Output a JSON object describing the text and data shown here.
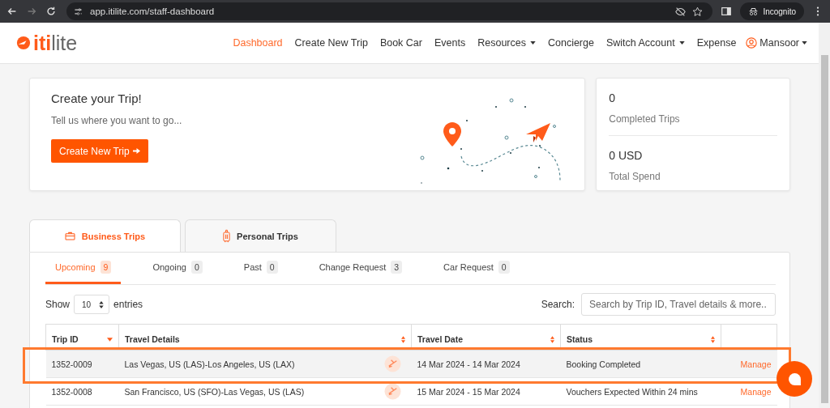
{
  "browser": {
    "url": "app.itilite.com/staff-dashboard",
    "profile": "Incognito"
  },
  "nav": {
    "logo_prefix": "iti",
    "logo_suffix": "lite",
    "items": [
      {
        "label": "Dashboard",
        "selected": true,
        "dropdown": false
      },
      {
        "label": "Create New Trip",
        "selected": false,
        "dropdown": false
      },
      {
        "label": "Book Car",
        "selected": false,
        "dropdown": false
      },
      {
        "label": "Events",
        "selected": false,
        "dropdown": false
      },
      {
        "label": "Resources",
        "selected": false,
        "dropdown": true
      },
      {
        "label": "Concierge",
        "selected": false,
        "dropdown": false
      },
      {
        "label": "Switch Account",
        "selected": false,
        "dropdown": true
      },
      {
        "label": "Expense",
        "selected": false,
        "dropdown": false
      }
    ],
    "user": "Mansoor"
  },
  "trip_card": {
    "title": "Create your Trip!",
    "subtitle": "Tell us where you want to go...",
    "button": "Create New Trip"
  },
  "stats": [
    {
      "value": "0",
      "label": "Completed Trips"
    },
    {
      "value": "0 USD",
      "label": "Total Spend"
    }
  ],
  "tabs": [
    {
      "label": "Business Trips",
      "selected": true,
      "kind": "briefcase"
    },
    {
      "label": "Personal Trips",
      "selected": false,
      "kind": "luggage"
    }
  ],
  "sub_tabs": [
    {
      "label": "Upcoming",
      "count": "9",
      "selected": true
    },
    {
      "label": "Ongoing",
      "count": "0",
      "selected": false
    },
    {
      "label": "Past",
      "count": "0",
      "selected": false
    },
    {
      "label": "Change Request",
      "count": "3",
      "selected": false
    },
    {
      "label": "Car Request",
      "count": "0",
      "selected": false
    }
  ],
  "entries": {
    "show": "Show",
    "value": "10",
    "suffix": "entries"
  },
  "search": {
    "label": "Search:",
    "placeholder": "Search by Trip ID, Travel details & more.."
  },
  "table": {
    "columns": [
      {
        "label": "Trip ID",
        "sortable": true,
        "sorted": true
      },
      {
        "label": "Travel Details",
        "sortable": true,
        "sorted": false
      },
      {
        "label": "Travel Date",
        "sortable": true,
        "sorted": false
      },
      {
        "label": "Status",
        "sortable": true,
        "sorted": false
      },
      {
        "sortable": false
      }
    ],
    "rows": [
      {
        "trip_id": "1352-0009",
        "details": "Las Vegas, US (LAS)-Los Angeles, US (LAX)",
        "date": "14 Mar 2024 - 14 Mar 2024",
        "status": "Booking Completed",
        "action": "Manage",
        "highlighted": true
      },
      {
        "trip_id": "1352-0008",
        "details": "San Francisco, US (SFO)-Las Vegas, US (LAS)",
        "date": "15 Mar 2024 - 15 Mar 2024",
        "status": "Vouchers Expected Within 24 mins",
        "action": "Manage",
        "highlighted": false
      }
    ]
  }
}
